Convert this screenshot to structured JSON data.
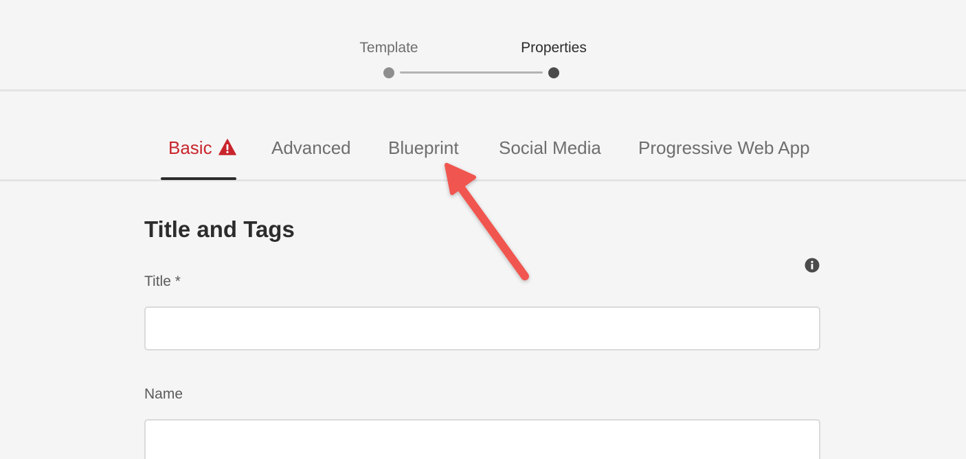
{
  "stepper": {
    "steps": [
      {
        "label": "Template",
        "state": "done"
      },
      {
        "label": "Properties",
        "state": "current"
      }
    ]
  },
  "tabs": [
    {
      "label": "Basic",
      "active": true,
      "icon": "warning-icon"
    },
    {
      "label": "Advanced",
      "active": false
    },
    {
      "label": "Blueprint",
      "active": false
    },
    {
      "label": "Social Media",
      "active": false
    },
    {
      "label": "Progressive Web App",
      "active": false
    }
  ],
  "form": {
    "section_title": "Title and Tags",
    "info_icon": "info-icon",
    "fields": [
      {
        "label": "Title *",
        "value": ""
      },
      {
        "label": "Name",
        "value": ""
      }
    ]
  },
  "annotation": {
    "icon": "arrow-pointer",
    "color": "#f0564f"
  },
  "colors": {
    "background": "#f5f5f5",
    "active_tab": "#c9252d",
    "arrow": "#f0564f"
  }
}
